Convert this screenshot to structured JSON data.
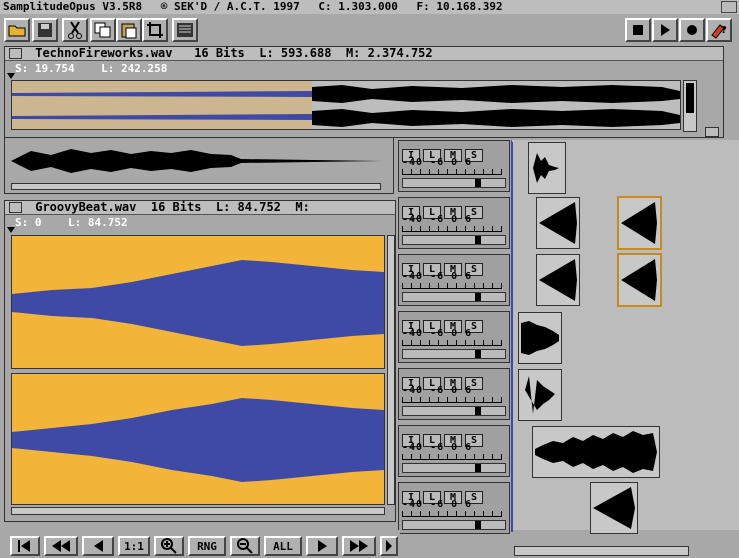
{
  "app_title": {
    "name": "SamplitudeOpus V3.5R8",
    "copyright": "® SEK'D / A.C.T. 1997",
    "counter_c": "C: 1.303.000",
    "counter_f": "F: 10.168.392"
  },
  "toolbar": {
    "left_icons": [
      "folder-open-icon",
      "save-icon",
      "scissors-icon",
      "copy-icon",
      "paste-icon",
      "crop-icon",
      "keyboard-icon"
    ],
    "transport_icons": [
      "stop-icon",
      "play-icon",
      "record-icon",
      "help-icon"
    ]
  },
  "windows": [
    {
      "title": "TechnoFireworks.wav",
      "bits": "16 Bits",
      "length": "L: 593.688",
      "marker": "M: 2.374.752",
      "start": "S: 19.754",
      "range_len": "L: 242.258"
    },
    {
      "title": "GroovyBeat.wav",
      "bits": "16 Bits",
      "length": "L: 84.752",
      "marker": "M:",
      "start": "S: 0",
      "range_len": "L: 84.752"
    }
  ],
  "track_controls": {
    "buttons": [
      "I",
      "L",
      "M",
      "S"
    ],
    "scale": "-40  -6  0  6",
    "count": 7
  },
  "bottom_toolbar": {
    "one_to_one": "1:1",
    "range": "RNG",
    "all": "ALL"
  },
  "colors": {
    "waveform": "#3f4aa6",
    "waveform_bg": "#f2b53a",
    "window_bg": "#a8a8a8",
    "selection": "#3f4aa6"
  }
}
